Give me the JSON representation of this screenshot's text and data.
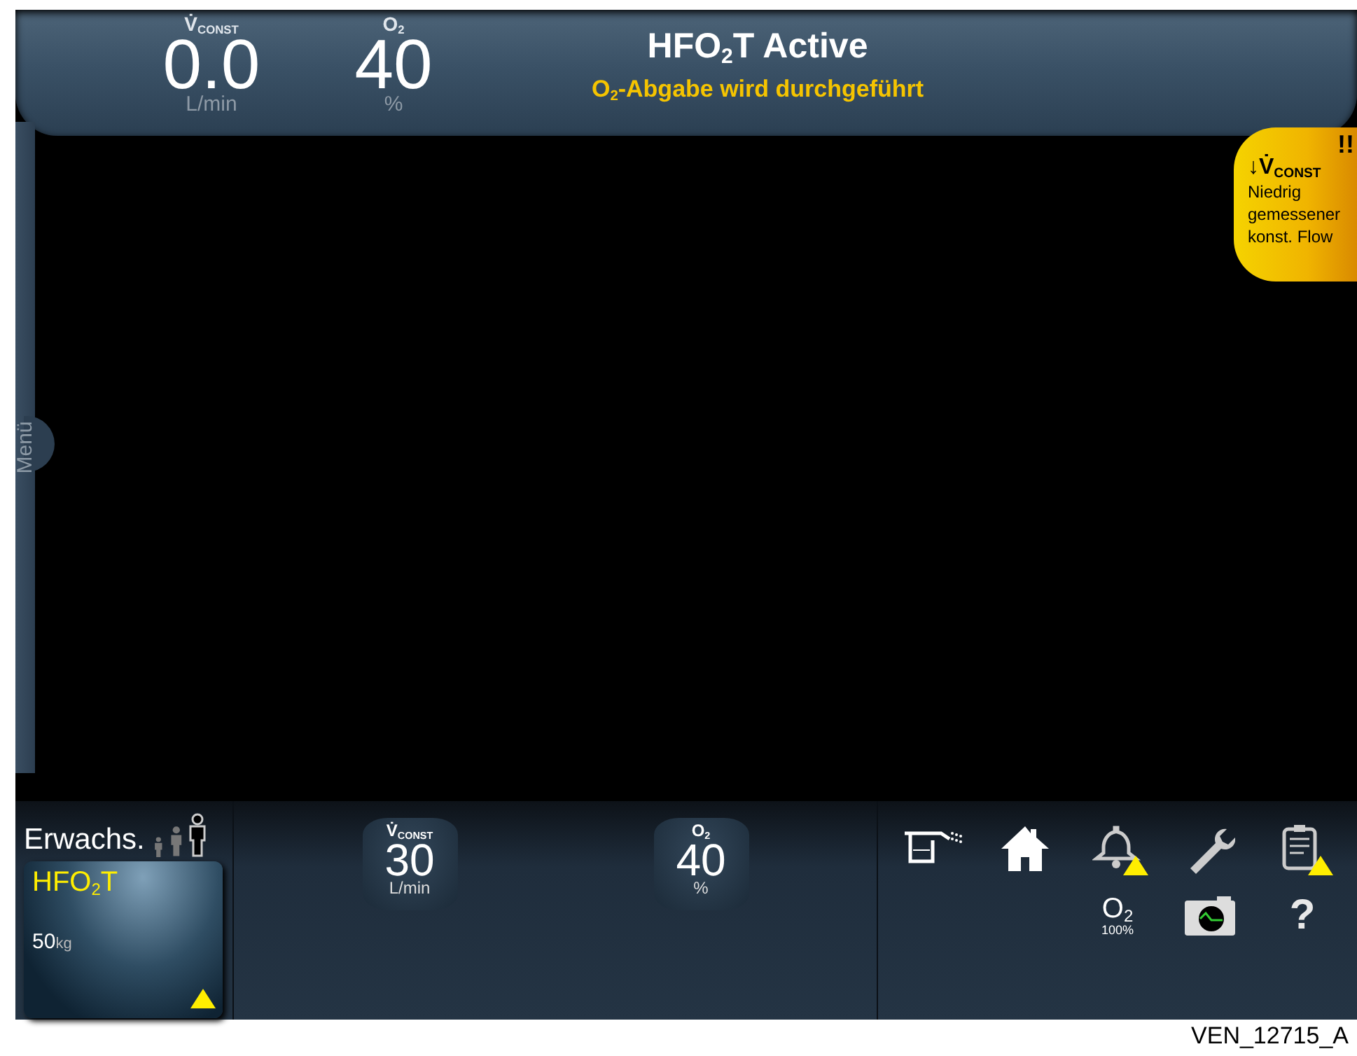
{
  "header": {
    "readings": [
      {
        "label": "V̇$_{CONST}$",
        "value": "0.0",
        "unit": "L/min"
      },
      {
        "label": "O$_{2}$",
        "value": "40",
        "unit": "%"
      }
    ],
    "title": "HFO$_{2}$T Active",
    "status": "O$_{2}$-Abgabe wird durchgeführt"
  },
  "menu_tab": {
    "label": "Menü"
  },
  "alarm": {
    "priority": "!!",
    "parameter": "↓V̇$_{CONST}$",
    "message": "Niedrig gemessener konst. Flow"
  },
  "patient": {
    "category": "Erwachs.",
    "mode": "HFO$_{2}$T",
    "weight": "50",
    "weight_unit": "kg",
    "warning": true,
    "types": [
      {
        "kind": "infant",
        "selected": false
      },
      {
        "kind": "child",
        "selected": false
      },
      {
        "kind": "adult",
        "selected": true
      }
    ]
  },
  "settings": [
    {
      "label": "V̇$_{CONST}$",
      "value": "30",
      "unit": "L/min"
    },
    {
      "label": "O$_{2}$",
      "value": "40",
      "unit": "%"
    }
  ],
  "toolbar": [
    {
      "kind": "nebulizer"
    },
    {
      "kind": "home"
    },
    {
      "kind": "alarm",
      "warning": true
    },
    {
      "kind": "tools"
    },
    {
      "kind": "logbook",
      "warning": true
    },
    {
      "kind": "o2",
      "label": "O$_{2}$",
      "sublabel": "100%"
    },
    {
      "kind": "screenshot"
    },
    {
      "kind": "help",
      "label": "?"
    }
  ],
  "caption": "VEN_12715_A"
}
